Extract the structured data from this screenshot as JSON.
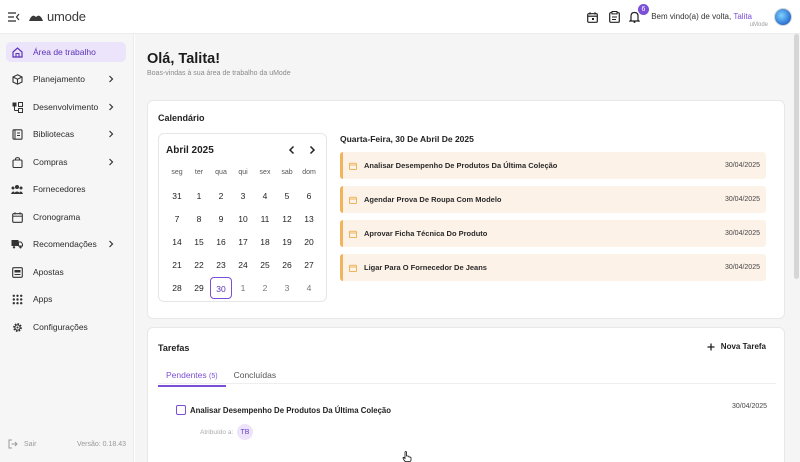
{
  "app": {
    "logo_text": "umode",
    "brand_color": "#7b4fd6"
  },
  "header": {
    "notification_count": "6",
    "welcome_text": "Bem vindo(a) de volta, ",
    "user_name": "Talita",
    "org_name": "uMode",
    "icons": [
      "calendar-icon",
      "clipboard-icon",
      "bell-icon"
    ]
  },
  "sidebar": {
    "items": [
      {
        "label": "Área de trabalho",
        "icon": "home-icon",
        "active": true,
        "has_chevron": false
      },
      {
        "label": "Planejamento",
        "icon": "cube-icon",
        "has_chevron": true
      },
      {
        "label": "Desenvolvimento",
        "icon": "nodes-icon",
        "has_chevron": true
      },
      {
        "label": "Bibliotecas",
        "icon": "book-icon",
        "has_chevron": true
      },
      {
        "label": "Compras",
        "icon": "bag-icon",
        "has_chevron": true
      },
      {
        "label": "Fornecedores",
        "icon": "people-icon",
        "has_chevron": false
      },
      {
        "label": "Cronograma",
        "icon": "calendar-icon",
        "has_chevron": false
      },
      {
        "label": "Recomendações",
        "icon": "truck-icon",
        "has_chevron": true
      },
      {
        "label": "Apostas",
        "icon": "chart-icon",
        "has_chevron": false
      },
      {
        "label": "Apps",
        "icon": "grid-icon",
        "has_chevron": false
      },
      {
        "label": "Configurações",
        "icon": "gear-icon",
        "has_chevron": false
      }
    ],
    "logout_label": "Sair",
    "version": "Versão: 0.18.43"
  },
  "main": {
    "greeting": "Olá, Talita!",
    "subtitle": "Boas-vindas à sua área de trabalho da uMode"
  },
  "calendar": {
    "title": "Calendário",
    "month_label": "Abril 2025",
    "weekdays": [
      "seg",
      "ter",
      "qua",
      "qui",
      "sex",
      "sab",
      "dom"
    ],
    "weeks": [
      [
        "31",
        "1",
        "2",
        "3",
        "4",
        "5",
        "6"
      ],
      [
        "7",
        "8",
        "9",
        "10",
        "11",
        "12",
        "13"
      ],
      [
        "14",
        "15",
        "16",
        "17",
        "18",
        "19",
        "20"
      ],
      [
        "21",
        "22",
        "23",
        "24",
        "25",
        "26",
        "27"
      ],
      [
        "28",
        "29",
        "30",
        "1",
        "2",
        "3",
        "4"
      ]
    ],
    "selected_day": "30",
    "events_title": "Quarta-Feira, 30 De Abril De 2025",
    "events": [
      {
        "title": "Analisar Desempenho De Produtos Da Última Coleção",
        "date": "30/04/2025"
      },
      {
        "title": "Agendar Prova De Roupa Com Modelo",
        "date": "30/04/2025"
      },
      {
        "title": "Aprovar Ficha Técnica Do Produto",
        "date": "30/04/2025"
      },
      {
        "title": "Ligar Para O Fornecedor De Jeans",
        "date": "30/04/2025"
      }
    ],
    "event_color": "#f0b45c"
  },
  "tasks": {
    "title": "Tarefas",
    "new_task_label": "Nova Tarefa",
    "tabs": [
      {
        "label": "Pendentes",
        "count": "(5)"
      },
      {
        "label": "Concluídas"
      }
    ],
    "items": [
      {
        "title": "Analisar Desempenho De Produtos Da Última Coleção",
        "date": "30/04/2025",
        "assigned_label": "Atribuído a:",
        "assignee_initials": "TB"
      }
    ]
  }
}
